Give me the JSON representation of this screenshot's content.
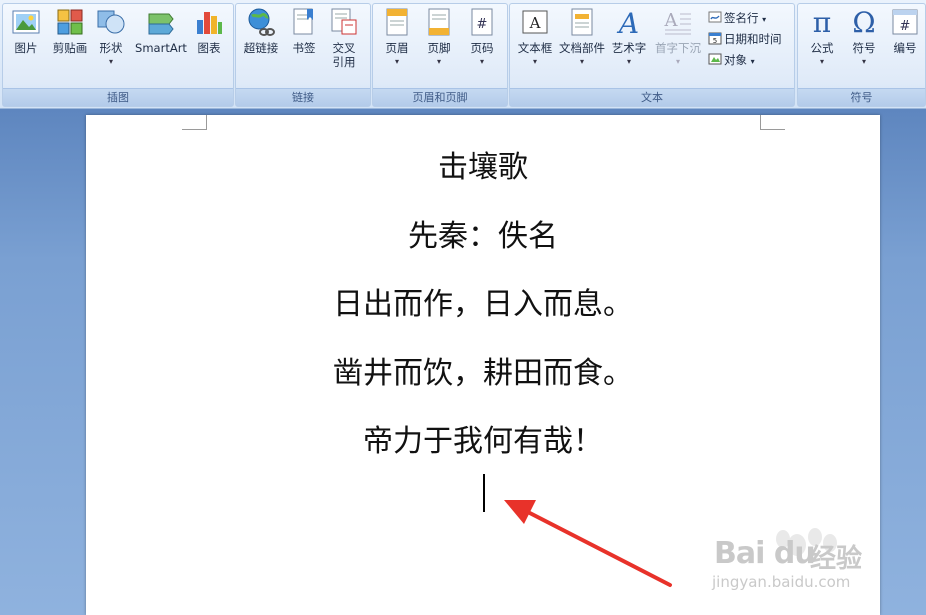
{
  "ribbon": {
    "groups": {
      "illustrations": {
        "label": "插图",
        "picture": "图片",
        "clipart": "剪贴画",
        "shapes": "形状",
        "smartart": "SmartArt",
        "chart": "图表"
      },
      "links": {
        "label": "链接",
        "hyperlink": "超链接",
        "bookmark": "书签",
        "crossref_line1": "交叉",
        "crossref_line2": "引用"
      },
      "header_footer": {
        "label": "页眉和页脚",
        "header": "页眉",
        "footer": "页脚",
        "page_number": "页码"
      },
      "text": {
        "label": "文本",
        "textbox": "文本框",
        "quickparts": "文档部件",
        "wordart": "艺术字",
        "dropcap": "首字下沉",
        "signature": "签名行",
        "datetime": "日期和时间",
        "object": "对象"
      },
      "symbols": {
        "label": "符号",
        "equation": "公式",
        "symbol": "符号",
        "numbering": "编号"
      }
    }
  },
  "document": {
    "lines": [
      "击壤歌",
      "先秦：佚名",
      "日出而作，日入而息。",
      "凿井而饮，耕田而食。",
      "帝力于我何有哉！"
    ]
  },
  "watermark": {
    "brand": "Bai du",
    "brand_cn": "经验",
    "url": "jingyan.baidu.com"
  },
  "colors": {
    "ribbon_bg": "#dfeaf8",
    "workspace_bg": "#7aa0d2",
    "arrow": "#e8322a"
  }
}
